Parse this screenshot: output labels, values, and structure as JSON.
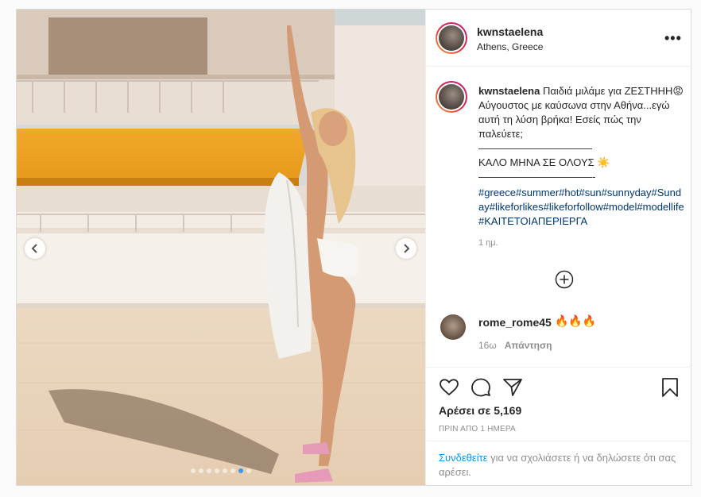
{
  "post": {
    "username": "kwnstaelena",
    "location": "Athens, Greece",
    "more_label": "•••",
    "caption": {
      "text": "Παιδιά μιλάμε για ΖΕΣΤΗΗΗ😡Αύγουστος με καύσωνα στην Αθήνα...εγώ αυτή τη λύση βρήκα! Εσείς πώς την παλεύετε;\n———————————\nΚΑΛΟ ΜΗΝΑ ΣΕ ΟΛΟΥΣ ☀️\n———————————-",
      "hashtags": "#greece#summer#hot#sun#sunnyday#Sunday#likeforlikes#likeforfollow#model#modellife#ΚΑΙΤΕΤΟΙΑΠΕΡΙΕΡΓΑ",
      "time": "1 ημ."
    },
    "comments": [
      {
        "username": "rome_rome45",
        "text": "🔥🔥🔥",
        "time": "16ω",
        "reply_label": "Απάντηση"
      }
    ],
    "likes": "Αρέσει σε 5,169",
    "date": "ΠΡΙΝ ΑΠΟ 1 ΗΜΕΡΑ",
    "login_prompt": {
      "link": "Συνδεθείτε",
      "text": " για να σχολιάσετε ή να δηλώσετε ότι σας αρέσει."
    }
  },
  "carousel": {
    "total": 8,
    "active_index": 6
  },
  "icons": {
    "prev": "chevron-left-icon",
    "next": "chevron-right-icon",
    "load_more": "plus-circle-icon",
    "like": "heart-icon",
    "comment": "comment-icon",
    "share": "paper-plane-icon",
    "save": "bookmark-icon"
  },
  "colors": {
    "link": "#00376b",
    "login_link": "#0095f6",
    "active_dot": "#3897f0",
    "muted": "#8e8e8e"
  }
}
